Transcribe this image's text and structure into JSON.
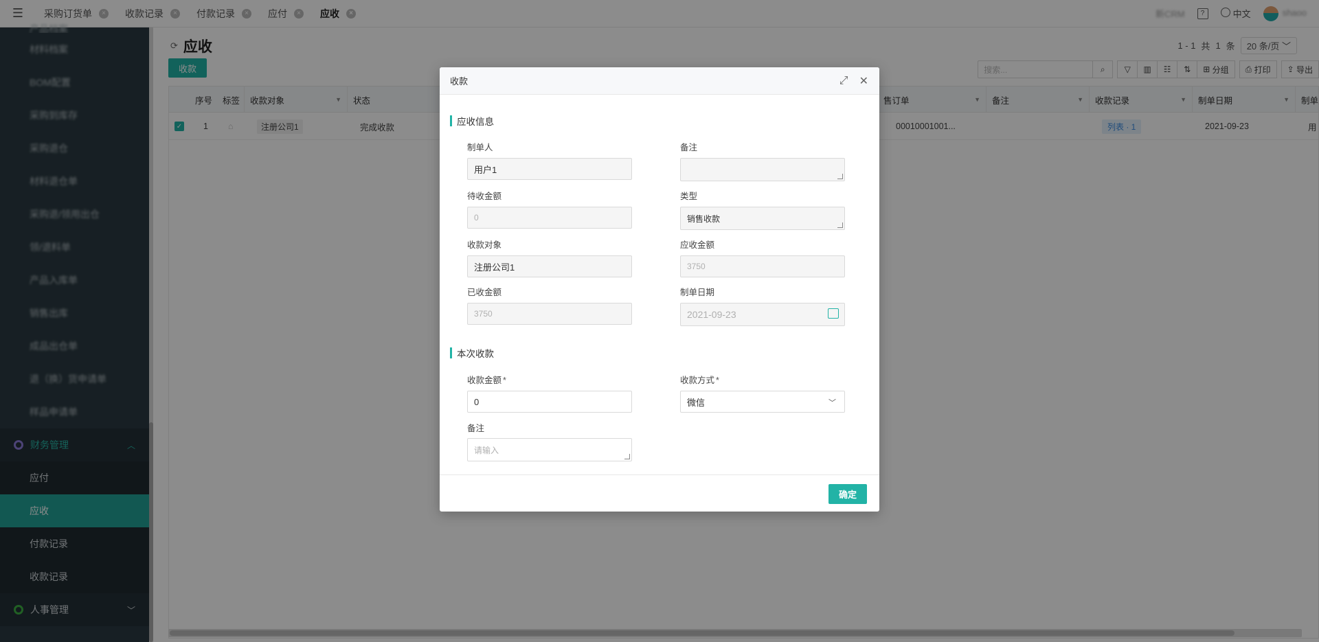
{
  "topbar": {
    "tabs": [
      {
        "label": "采购订货单"
      },
      {
        "label": "收款记录"
      },
      {
        "label": "付款记录"
      },
      {
        "label": "应付"
      },
      {
        "label": "应收"
      }
    ],
    "company": "新CRM",
    "language": "中文",
    "user": "shaoo"
  },
  "sidebar": {
    "items": [
      {
        "label": "产品档案"
      },
      {
        "label": "材料档案"
      },
      {
        "label": "BOM配置"
      },
      {
        "label": "采购到库存"
      },
      {
        "label": "采购退仓"
      },
      {
        "label": "材料退仓单"
      },
      {
        "label": "采购退/领用出仓"
      },
      {
        "label": "领/退料单"
      },
      {
        "label": "产品入库单"
      },
      {
        "label": "销售出库"
      },
      {
        "label": "成品出仓单"
      },
      {
        "label": "退（换）货申请单"
      },
      {
        "label": "样品申请单"
      }
    ],
    "finance_group": "财务管理",
    "finance_items": [
      {
        "label": "应付"
      },
      {
        "label": "应收"
      },
      {
        "label": "付款记录"
      },
      {
        "label": "收款记录"
      }
    ],
    "hr_group": "人事管理"
  },
  "main": {
    "title": "应收",
    "pager": {
      "range": "1 - 1",
      "total_prefix": "共",
      "total": "1",
      "total_suffix": "条",
      "page_size": "20 条/页"
    },
    "receive_button": "收款",
    "search_placeholder": "搜索...",
    "group_label": "分组",
    "print_label": "打印",
    "export_label": "导出",
    "columns": [
      "序号",
      "标签",
      "收款对象",
      "状态",
      "售订单",
      "备注",
      "收款记录",
      "制单日期",
      "制单人"
    ],
    "row": {
      "index": "1",
      "target": "注册公司1",
      "status": "完成收款",
      "order": "00010001001...",
      "records": "列表 · 1",
      "date": "2021-09-23",
      "creator": "用"
    }
  },
  "modal": {
    "title": "收款",
    "section1": "应收信息",
    "section2": "本次收款",
    "fields": {
      "creator_label": "制单人",
      "creator_value": "用户1",
      "remark_label": "备注",
      "remark_value": "",
      "pending_label": "待收金额",
      "pending_value": "0",
      "type_label": "类型",
      "type_value": "销售收款",
      "target_label": "收款对象",
      "target_value": "注册公司1",
      "receivable_label": "应收金额",
      "receivable_value": "3750",
      "received_label": "已收金额",
      "received_value": "3750",
      "date_label": "制单日期",
      "date_value": "2021-09-23",
      "amount_label": "收款金额",
      "amount_value": "0",
      "method_label": "收款方式",
      "method_value": "微信",
      "note_label": "备注",
      "note_placeholder": "请输入",
      "required_mark": "*"
    },
    "ok_button": "确定"
  }
}
